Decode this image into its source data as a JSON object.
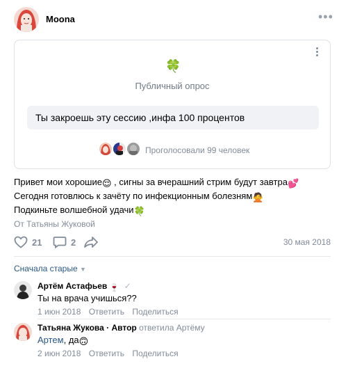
{
  "post": {
    "author": "Moona",
    "more_icon": "more-horizontal-icon",
    "poll": {
      "icon": "🍀",
      "type_label": "Публичный опрос",
      "option": "Ты закроешь эту сессию ,инфа 100 процентов",
      "voters_text": "Проголосовали 99 человек"
    },
    "text_lines": [
      "Привет мои хорошие",
      " , сигны за вчерашний стрим будут завтра",
      "Сегодня готовлюсь к зачёту по инфекционным болезням",
      "Подкиньте волшебной удачи"
    ],
    "signer": "От Татьяны Жуковой",
    "likes": "21",
    "comments_count": "2",
    "date": "30 мая 2018"
  },
  "sort_label": "Сначала старые",
  "comments": [
    {
      "author": "Артём Астафьев",
      "text": "Ты на врача учишься??",
      "date": "1 июн 2018",
      "reply": "Ответить",
      "share": "Поделиться"
    },
    {
      "author": "Татьяна Жукова · Автор",
      "reply_to": "ответила Артёму",
      "mention": "Артем",
      "text": ", да",
      "date": "2 июн 2018",
      "reply": "Ответить",
      "share": "Поделиться"
    }
  ],
  "colors": {
    "link": "#2a5885",
    "secondary": "#818c99",
    "option_bg": "#f0f2f5"
  }
}
